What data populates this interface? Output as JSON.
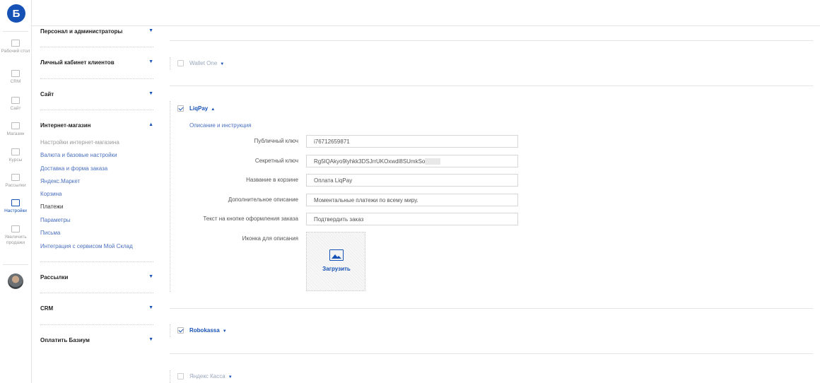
{
  "rail": {
    "logo": "Б",
    "items": [
      {
        "label": "Рабочий стол",
        "icon": "monitor-icon"
      },
      {
        "label": "CRM",
        "icon": "funnel-icon"
      },
      {
        "label": "Сайт",
        "icon": "pages-icon"
      },
      {
        "label": "Магазин",
        "icon": "store-icon"
      },
      {
        "label": "Курсы",
        "icon": "books-icon"
      },
      {
        "label": "Рассылки",
        "icon": "mail-icon"
      },
      {
        "label": "Настройки",
        "icon": "sliders-icon"
      },
      {
        "label": "Увеличить продажи",
        "icon": "hand-icon"
      }
    ]
  },
  "menu": {
    "sections": [
      {
        "label": "Персонал и администраторы",
        "caret": "▼"
      },
      {
        "label": "Личный кабинет клиентов",
        "caret": "▼"
      },
      {
        "label": "Сайт",
        "caret": "▼"
      },
      {
        "label": "Интернет-магазин",
        "caret": "▲"
      },
      {
        "label": "Рассылки",
        "caret": "▼"
      },
      {
        "label": "CRM",
        "caret": "▼"
      },
      {
        "label": "Оплатить Базиум",
        "caret": "▼"
      }
    ],
    "shop_items": [
      "Настройки интернет-магазина",
      "Валюта и базовые настройки",
      "Доставка и форма заказа",
      "Яндекс.Маркет",
      "Корзина",
      "Платежи",
      "Параметры",
      "Письма",
      "Интеграция с сервисом Мой Склад"
    ]
  },
  "payments": {
    "wallet_one": {
      "label": "Wallet One",
      "caret": "▼",
      "checked": false
    },
    "liqpay": {
      "label": "LiqPay",
      "caret": "▲",
      "checked": true,
      "description_link": "Описание и инструкция",
      "fields": {
        "public_key": {
          "label": "Публичный ключ",
          "value": "i76712659871"
        },
        "secret_key": {
          "label": "Секретный ключ",
          "value": "Rg5lQAkyo9lyhkk3DSJrrUKOxwdl8SUmkSo"
        },
        "cart_name": {
          "label": "Название в корзине",
          "value": "Оплата LiqPay"
        },
        "extra_description": {
          "label": "Дополнительное описание",
          "value": "Моментальные платежи по всему миру."
        },
        "button_text": {
          "label": "Текст на кнопке оформления заказа",
          "value": "Подтвердить заказ"
        }
      },
      "icon_label": "Иконка для описания",
      "upload_label": "Загрузить"
    },
    "robokassa": {
      "label": "Robokassa",
      "caret": "▼",
      "checked": true
    },
    "yandex_kassa": {
      "label": "Яндекс Касса",
      "caret": "▼",
      "checked": false
    }
  },
  "colors": {
    "accent": "#1652b5",
    "link": "#4a6fbf"
  }
}
